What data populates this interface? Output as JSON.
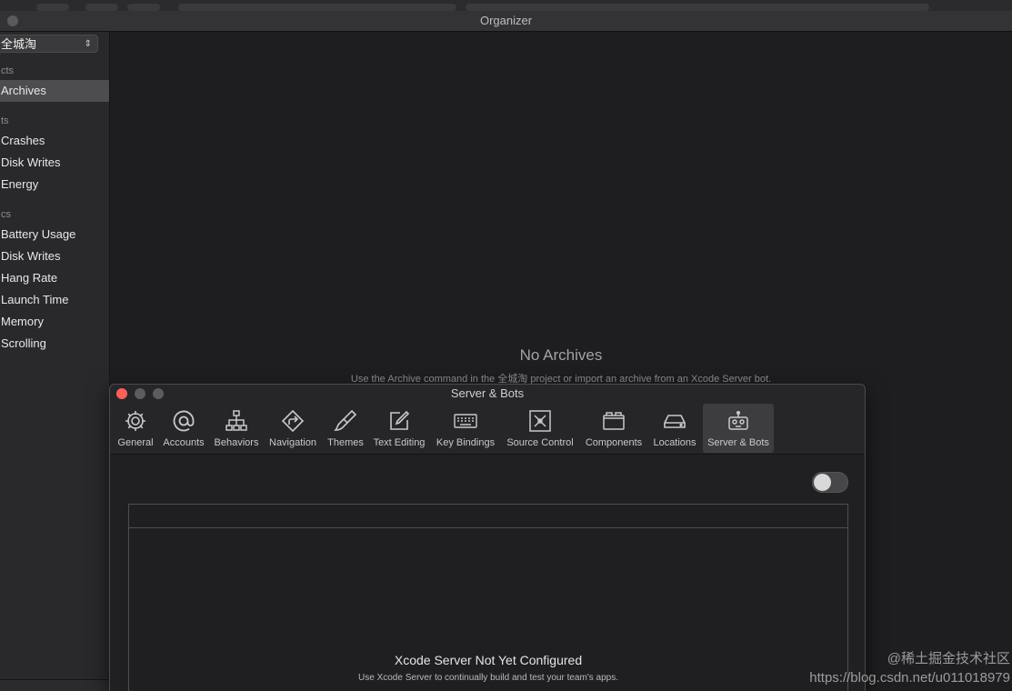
{
  "organizer": {
    "title": "Organizer",
    "scheme_select": "全城淘",
    "sidebar": {
      "groups": [
        "cts",
        "ts",
        "cs"
      ],
      "items": [
        "Archives",
        "Crashes",
        "Disk Writes",
        "Energy",
        "Battery Usage",
        "Disk Writes",
        "Hang Rate",
        "Launch Time",
        "Memory",
        "Scrolling"
      ]
    },
    "empty_state": {
      "title": "No Archives",
      "subtitle": "Use the Archive command in the 全城淘 project or import an archive from an Xcode Server bot."
    }
  },
  "prefs": {
    "title": "Server & Bots",
    "toolbar": [
      {
        "label": "General",
        "icon": "gear-icon"
      },
      {
        "label": "Accounts",
        "icon": "at-sign-icon"
      },
      {
        "label": "Behaviors",
        "icon": "hierarchy-icon"
      },
      {
        "label": "Navigation",
        "icon": "navigation-arrow-icon"
      },
      {
        "label": "Themes",
        "icon": "paintbrush-icon"
      },
      {
        "label": "Text Editing",
        "icon": "pencil-square-icon"
      },
      {
        "label": "Key Bindings",
        "icon": "keyboard-icon"
      },
      {
        "label": "Source Control",
        "icon": "source-control-icon"
      },
      {
        "label": "Components",
        "icon": "folders-icon"
      },
      {
        "label": "Locations",
        "icon": "drive-icon"
      },
      {
        "label": "Server & Bots",
        "icon": "robot-icon"
      }
    ],
    "server": {
      "title": "Xcode Server Not Yet Configured",
      "subtitle": "Use Xcode Server to continually build and test your team's apps.",
      "enabled": false
    }
  },
  "watermark": {
    "line1": "@稀土掘金技术社区",
    "line2": "https://blog.csdn.net/u011018979"
  },
  "colors": {
    "close": "#fc5f57",
    "selected_item": "#4d4d50"
  }
}
